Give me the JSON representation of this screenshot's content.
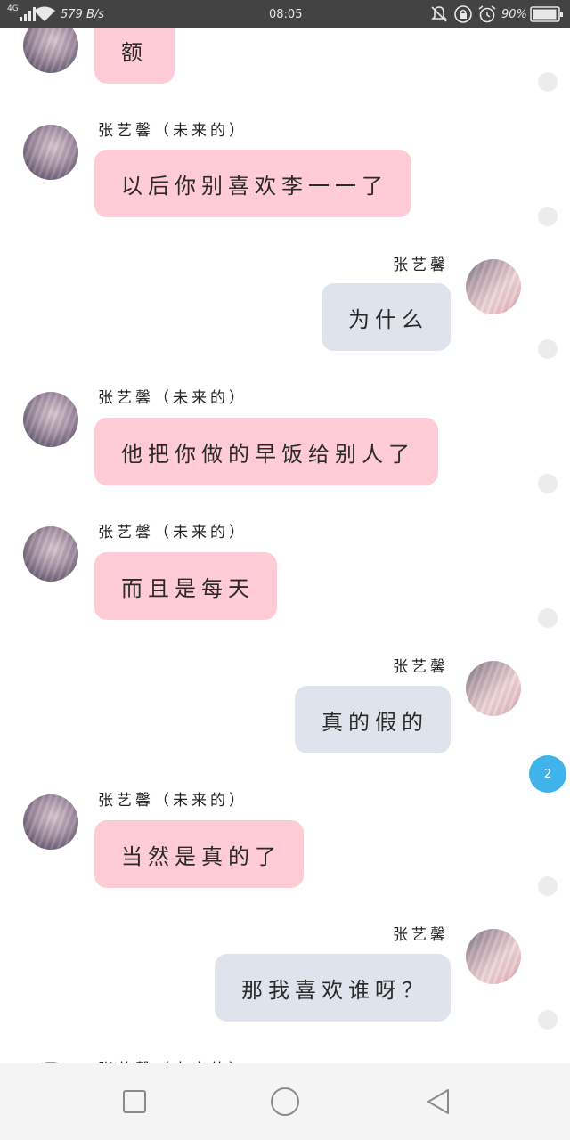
{
  "status_bar": {
    "network": "4G",
    "speed": "579 B/s",
    "time": "08:05",
    "battery": "90%"
  },
  "messages": [
    {
      "side": "left",
      "name": "",
      "text": "额"
    },
    {
      "side": "left",
      "name": "张艺馨（未来的）",
      "text": "以后你别喜欢李一一了"
    },
    {
      "side": "right",
      "name": "张艺馨",
      "text": "为什么"
    },
    {
      "side": "left",
      "name": "张艺馨（未来的）",
      "text": "他把你做的早饭给别人了"
    },
    {
      "side": "left",
      "name": "张艺馨（未来的）",
      "text": "而且是每天"
    },
    {
      "side": "right",
      "name": "张艺馨",
      "text": "真的假的"
    },
    {
      "side": "left",
      "name": "张艺馨（未来的）",
      "text": "当然是真的了"
    },
    {
      "side": "right",
      "name": "张艺馨",
      "text": "那我喜欢谁呀？"
    },
    {
      "side": "left",
      "name": "张艺馨（未来的）",
      "text": ""
    }
  ],
  "unread_badge": "2",
  "nav": {
    "recents": "recents-square-icon",
    "home": "home-circle-icon",
    "back": "back-triangle-icon"
  },
  "colors": {
    "left_bubble": "#ffcbd7",
    "right_bubble": "#dfe3eb",
    "badge": "#3fb3ea",
    "status_bar": "#434343"
  }
}
